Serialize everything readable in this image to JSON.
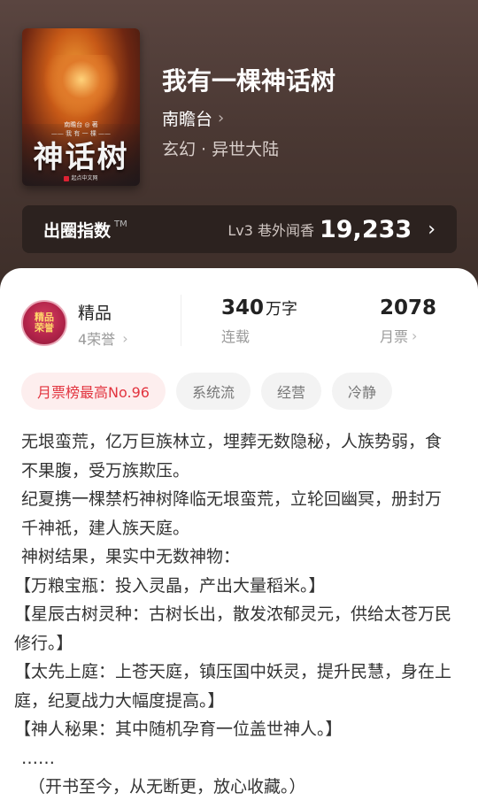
{
  "book": {
    "cover": {
      "author_line": "南瞻台 ◎ 著",
      "sub_line": "—— 我 有 一 棵 ——",
      "title": "神话树",
      "publisher": "起点中文网"
    },
    "title": "我有一棵神话树",
    "author": "南瞻台",
    "genre": "玄幻 · 异世大陆"
  },
  "index_bar": {
    "label": "出圈指数",
    "tm": "TM",
    "level": "Lv3 巷外闻香",
    "value": "19,233"
  },
  "badge": {
    "text": "精品\n荣誉"
  },
  "stats": {
    "quality": {
      "main": "精品",
      "sub": "4荣誉"
    },
    "words": {
      "number": "340",
      "unit": "万字",
      "sub": "连载"
    },
    "tickets": {
      "number": "2078",
      "sub": "月票"
    }
  },
  "tags": [
    "月票榜最高No.96",
    "系统流",
    "经营",
    "冷静"
  ],
  "synopsis": [
    "无垠蛮荒，亿万巨族林立，埋葬无数隐秘，人族势弱，食不果腹，受万族欺压。",
    "纪夏携一棵禁朽神树降临无垠蛮荒，立轮回幽冥，册封万千神祇，建人族天庭。",
    "神树结果，果实中无数神物：",
    "【万粮宝瓶：投入灵晶，产出大量稻米。】",
    "【星辰古树灵种：古树长出，散发浓郁灵元，供给太苍万民修行。】",
    "【太先上庭：上苍天庭，镇压国中妖灵，提升民慧，身在上庭，纪夏战力大幅度提高。】",
    "【神人秘果：其中随机孕育一位盖世神人。】",
    "……",
    "（开书至今，从无断更，放心收藏。）"
  ],
  "icons": {
    "chevron": "chevron-right-icon"
  },
  "colors": {
    "hero_bg": "#4a3833",
    "accent_red": "#e2343f",
    "card_bg": "#ffffff"
  }
}
